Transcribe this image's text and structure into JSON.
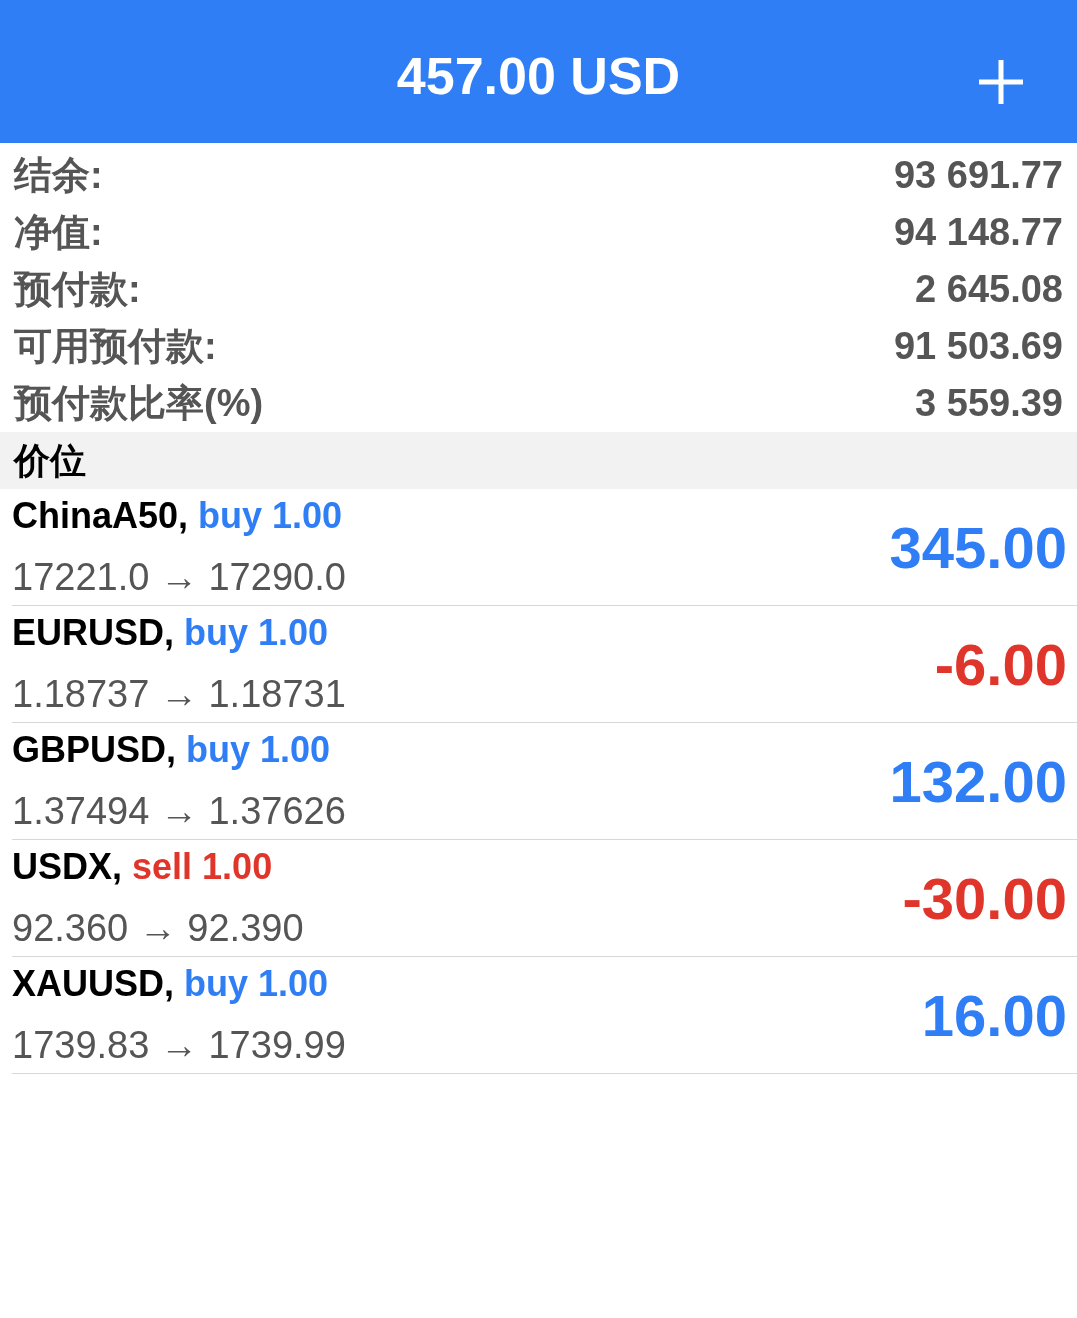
{
  "header": {
    "title": "457.00 USD"
  },
  "summary": [
    {
      "label": "结余:",
      "value": "93 691.77"
    },
    {
      "label": "净值:",
      "value": "94 148.77"
    },
    {
      "label": "预付款:",
      "value": "2 645.08"
    },
    {
      "label": "可用预付款:",
      "value": "91 503.69"
    },
    {
      "label": "预付款比率(%)",
      "value": "3 559.39"
    }
  ],
  "section": {
    "title": "价位"
  },
  "positions": [
    {
      "symbol": "ChinaA50,",
      "order": {
        "kind": "buy",
        "text": "buy 1.00"
      },
      "prices": "17221.0 → 17290.0",
      "profit": {
        "kind": "gain",
        "text": "345.00"
      }
    },
    {
      "symbol": "EURUSD,",
      "order": {
        "kind": "buy",
        "text": "buy 1.00"
      },
      "prices": "1.18737 → 1.18731",
      "profit": {
        "kind": "loss",
        "text": "-6.00"
      }
    },
    {
      "symbol": "GBPUSD,",
      "order": {
        "kind": "buy",
        "text": "buy 1.00"
      },
      "prices": "1.37494 → 1.37626",
      "profit": {
        "kind": "gain",
        "text": "132.00"
      }
    },
    {
      "symbol": "USDX,",
      "order": {
        "kind": "sell",
        "text": "sell 1.00"
      },
      "prices": "92.360 → 92.390",
      "profit": {
        "kind": "loss",
        "text": "-30.00"
      }
    },
    {
      "symbol": "XAUUSD,",
      "order": {
        "kind": "buy",
        "text": "buy 1.00"
      },
      "prices": "1739.83 → 1739.99",
      "profit": {
        "kind": "gain",
        "text": "16.00"
      }
    }
  ]
}
